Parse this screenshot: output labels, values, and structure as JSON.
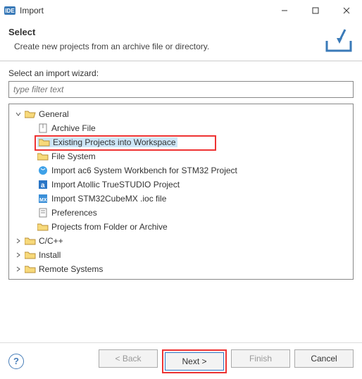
{
  "window": {
    "title": "Import",
    "app_icon_text": "IDE"
  },
  "header": {
    "title": "Select",
    "description": "Create new projects from an archive file or directory."
  },
  "body": {
    "wizard_label": "Select an import wizard:",
    "filter_placeholder": "type filter text"
  },
  "tree": {
    "general": {
      "label": "General",
      "children": {
        "archive": "Archive File",
        "existing": "Existing Projects into Workspace",
        "filesystem": "File System",
        "ac6": "Import ac6 System Workbench for STM32 Project",
        "atollic": "Import Atollic TrueSTUDIO Project",
        "cubemx": "Import STM32CubeMX .ioc file",
        "preferences": "Preferences",
        "projectsfolder": "Projects from Folder or Archive"
      }
    },
    "ccpp": "C/C++",
    "install": "Install",
    "remote": "Remote Systems"
  },
  "buttons": {
    "back": "< Back",
    "next": "Next >",
    "finish": "Finish",
    "cancel": "Cancel",
    "help": "?"
  }
}
